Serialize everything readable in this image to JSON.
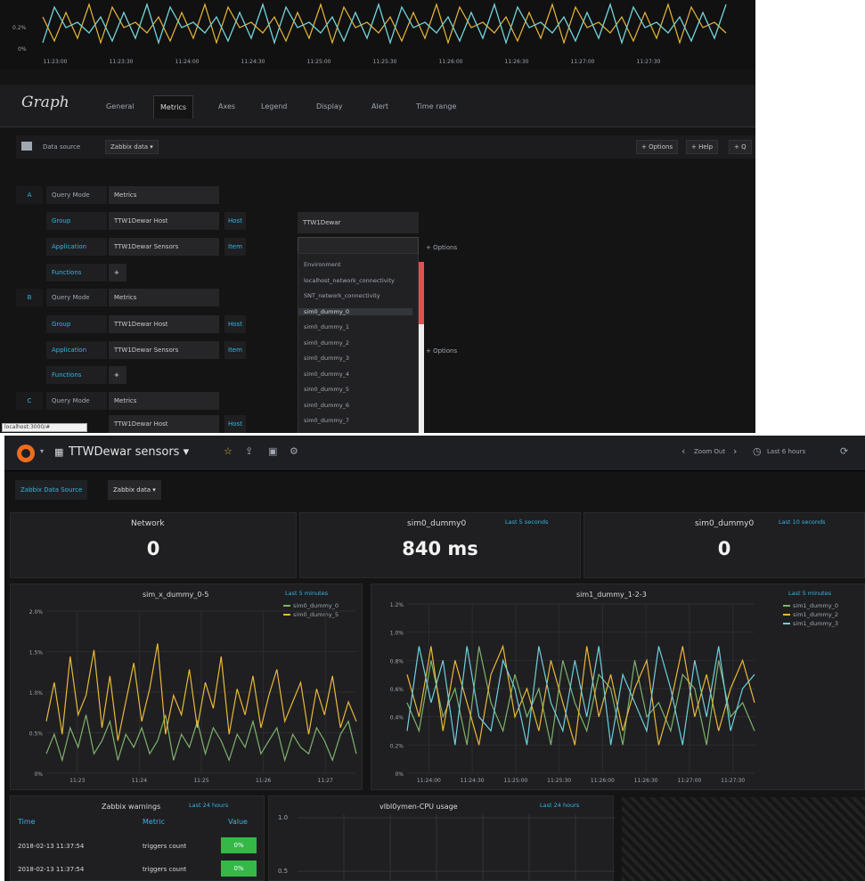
{
  "top_chart": {
    "y_ticks": [
      "0.2%",
      "0%"
    ],
    "x_ticks": [
      "11:23:00",
      "11:23:30",
      "11:24:00",
      "11:24:30",
      "11:25:00",
      "11:25:30",
      "11:26:00",
      "11:26:30",
      "11:27:00",
      "11:27:30"
    ],
    "colors": [
      "#7eb26d",
      "#eab839",
      "#6ed0e0"
    ]
  },
  "editor": {
    "title": "Graph",
    "tabs": [
      "General",
      "Metrics",
      "Axes",
      "Legend",
      "Display",
      "Alert",
      "Time range"
    ],
    "active_tab": "Metrics",
    "data_source_label": "Data source",
    "data_source_value": "Zabbix data ▾",
    "right_buttons": [
      "+ Options",
      "+ Help",
      "+ Q"
    ],
    "queries": [
      {
        "ref": "A",
        "mode_label": "Query Mode",
        "mode_value": "Metrics",
        "group_label": "Group",
        "group_value": "TTW1Dewar Host",
        "host_label": "Host",
        "application_label": "Application",
        "application_value": "TTW1Dewar Sensors",
        "item_label": "Item",
        "functions_label": "Functions",
        "options_label": "+ Options"
      },
      {
        "ref": "B",
        "mode_label": "Query Mode",
        "mode_value": "Metrics",
        "group_label": "Group",
        "group_value": "TTW1Dewar Host",
        "host_label": "Host",
        "application_label": "Application",
        "application_value": "TTW1Dewar Sensors",
        "item_label": "Item",
        "functions_label": "Functions",
        "options_label": "+ Options"
      },
      {
        "ref": "C",
        "mode_label": "Query Mode",
        "mode_value": "Metrics",
        "group_value": "TTW1Dewar Host",
        "host_label": "Host"
      }
    ],
    "host_value": "TTW1Dewar",
    "dropdown_items": [
      "Environment",
      "localhost_network_connectivity",
      "SNT_network_connectivity",
      "sim0_dummy_0",
      "sim0_dummy_1",
      "sim0_dummy_2",
      "sim0_dummy_3",
      "sim0_dummy_4",
      "sim0_dummy_5",
      "sim0_dummy_6",
      "sim0_dummy_7"
    ],
    "dropdown_active": "sim0_dummy_0",
    "url_tooltip": "localhost:3000/#"
  },
  "dashboard": {
    "title": "TTWDewar sensors ▾",
    "zoom_out": "Zoom Out",
    "time_range": "Last 6 hours",
    "template_label": "Zabbix Data Source",
    "template_value": "Zabbix data ▾",
    "stats": [
      {
        "title": "Network",
        "value": "0",
        "time": ""
      },
      {
        "title": "sim0_dummy0",
        "value": "840 ms",
        "time": "Last 5 seconds"
      },
      {
        "title": "sim0_dummy0",
        "value": "0",
        "time": "Last 10 seconds"
      }
    ],
    "graph_left": {
      "title": "sim_x_dummy_0-5",
      "time": "Last 5 minutes",
      "legend": [
        {
          "name": "sim0_dummy_0",
          "color": "#7eb26d"
        },
        {
          "name": "sim0_dummy_5",
          "color": "#eab839"
        }
      ]
    },
    "graph_right": {
      "title": "sim1_dummy_1-2-3",
      "time": "Last 5 minutes",
      "legend": [
        {
          "name": "sim1_dummy_0",
          "color": "#7eb26d"
        },
        {
          "name": "sim1_dummy_2",
          "color": "#eab839"
        },
        {
          "name": "sim1_dummy_3",
          "color": "#6ed0e0"
        }
      ]
    },
    "warnings": {
      "title": "Zabbix warnings",
      "time": "Last 24 hours",
      "columns": [
        "Time",
        "Metric",
        "Value"
      ],
      "rows": [
        {
          "time": "2018-02-13 11:37:54",
          "metric": "triggers count",
          "value": "0%"
        },
        {
          "time": "2018-02-13 11:37:54",
          "metric": "triggers count",
          "value": "0%"
        }
      ]
    },
    "cpu": {
      "title": "vlbl0ymen-CPU usage",
      "time": "Last 24 hours",
      "y_ticks": [
        "1.0",
        "0.5"
      ]
    }
  },
  "chart_data": [
    {
      "type": "line",
      "title": "sim_x_dummy_0-5",
      "x": [
        "11:23",
        "11:24",
        "11:25",
        "11:26",
        "11:27"
      ],
      "ylim": [
        0,
        2.5
      ],
      "y_ticks": [
        "2.0%",
        "1.5%",
        "1.0%",
        "0.5%",
        "0%"
      ],
      "series": [
        {
          "name": "sim0_dummy_0",
          "color": "#7eb26d",
          "values": [
            0.3,
            0.6,
            0.2,
            0.7,
            0.4,
            0.9,
            0.3,
            0.5,
            0.8,
            0.2,
            0.6,
            0.4,
            0.7,
            0.3,
            0.5,
            0.9,
            0.2,
            0.6,
            0.4,
            0.8,
            0.3,
            0.7,
            0.5,
            0.2,
            0.6,
            0.4,
            0.8,
            0.3,
            0.5,
            0.7,
            0.2,
            0.6,
            0.4,
            0.3,
            0.7,
            0.5,
            0.2,
            0.6,
            0.8,
            0.3
          ]
        },
        {
          "name": "sim0_dummy_5",
          "color": "#eab839",
          "values": [
            0.8,
            1.4,
            0.6,
            1.8,
            0.9,
            1.2,
            1.9,
            0.7,
            1.5,
            0.5,
            1.1,
            1.7,
            0.8,
            1.3,
            2.0,
            0.6,
            1.2,
            0.9,
            1.6,
            0.7,
            1.4,
            1.0,
            1.8,
            0.6,
            1.3,
            0.9,
            1.5,
            0.7,
            1.2,
            1.6,
            0.8,
            1.1,
            1.4,
            0.6,
            1.3,
            0.9,
            1.5,
            0.7,
            1.1,
            0.8
          ]
        }
      ]
    },
    {
      "type": "line",
      "title": "sim1_dummy_1-2-3",
      "x": [
        "11:24:00",
        "11:24:30",
        "11:25:00",
        "11:25:30",
        "11:26:00",
        "11:26:30",
        "11:27:00",
        "11:27:30"
      ],
      "ylim": [
        0,
        1.2
      ],
      "y_ticks": [
        "1.2%",
        "1.0%",
        "0.8%",
        "0.6%",
        "0.4%",
        "0.2%",
        "0%"
      ],
      "series": [
        {
          "name": "sim1_dummy_0",
          "color": "#7eb26d",
          "values": [
            0.5,
            0.3,
            0.8,
            0.4,
            0.6,
            0.2,
            0.9,
            0.5,
            0.3,
            0.7,
            0.4,
            0.6,
            0.2,
            0.8,
            0.5,
            0.3,
            0.7,
            0.6,
            0.2,
            0.8,
            0.4,
            0.5,
            0.3,
            0.7,
            0.6,
            0.2,
            0.8,
            0.4,
            0.5,
            0.3
          ]
        },
        {
          "name": "sim1_dummy_2",
          "color": "#eab839",
          "values": [
            0.7,
            0.4,
            0.9,
            0.3,
            0.8,
            0.5,
            0.2,
            0.7,
            0.9,
            0.4,
            0.6,
            0.3,
            0.8,
            0.5,
            0.2,
            0.9,
            0.4,
            0.7,
            0.3,
            0.6,
            0.8,
            0.2,
            0.5,
            0.9,
            0.4,
            0.7,
            0.3,
            0.6,
            0.8,
            0.5
          ]
        },
        {
          "name": "sim1_dummy_3",
          "color": "#6ed0e0",
          "values": [
            0.3,
            0.9,
            0.5,
            0.8,
            0.2,
            0.9,
            0.4,
            0.3,
            0.8,
            0.6,
            0.2,
            0.9,
            0.5,
            0.3,
            0.8,
            0.4,
            0.9,
            0.2,
            0.7,
            0.5,
            0.3,
            0.9,
            0.6,
            0.2,
            0.8,
            0.4,
            0.9,
            0.3,
            0.6,
            0.7
          ]
        }
      ]
    }
  ]
}
